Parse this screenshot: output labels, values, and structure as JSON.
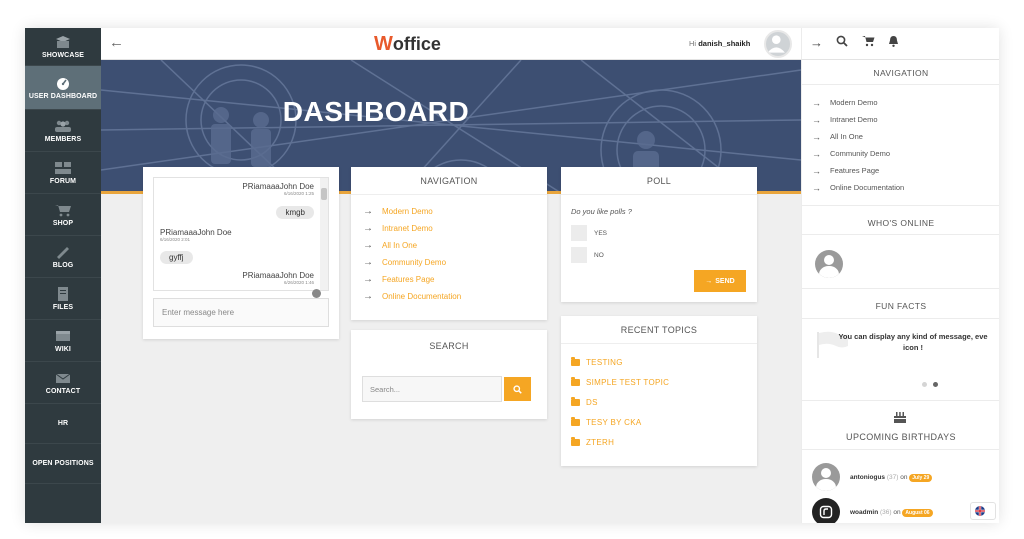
{
  "sidebar": {
    "items": [
      {
        "label": "SHOWCASE",
        "icon": "showcase-icon"
      },
      {
        "label": "USER DASHBOARD",
        "icon": "dashboard-gauge-icon"
      },
      {
        "label": "MEMBERS",
        "icon": "members-icon"
      },
      {
        "label": "FORUM",
        "icon": "forum-icon"
      },
      {
        "label": "SHOP",
        "icon": "cart-icon"
      },
      {
        "label": "BLOG",
        "icon": "blog-icon"
      },
      {
        "label": "FILES",
        "icon": "files-icon"
      },
      {
        "label": "WIKI",
        "icon": "wiki-icon"
      },
      {
        "label": "CONTACT",
        "icon": "contact-icon"
      },
      {
        "label": "HR",
        "icon": ""
      },
      {
        "label": "OPEN POSITIONS",
        "icon": ""
      }
    ]
  },
  "header": {
    "logo_first": "W",
    "logo_rest": "office",
    "greeting": "Hi",
    "username": "danish_shaikh"
  },
  "hero": {
    "title": "DASHBOARD"
  },
  "chat": {
    "messages": [
      {
        "name": "PRiamaaaJohn Doe",
        "time": "6/16/2020 1:25",
        "text": "kmgb",
        "side": "right"
      },
      {
        "name": "PRiamaaaJohn Doe",
        "time": "6/16/2020 2:01",
        "text": "gyffj",
        "side": "left"
      },
      {
        "name": "PRiamaaaJohn Doe",
        "time": "6/26/2020 1:46",
        "text": "",
        "side": "right"
      }
    ],
    "input_placeholder": "Enter message here"
  },
  "navigation_widget": {
    "title": "NAVIGATION",
    "items": [
      "Modern Demo",
      "Intranet Demo",
      "All In One",
      "Community Demo",
      "Features Page",
      "Online Documentation"
    ]
  },
  "search_widget": {
    "title": "SEARCH",
    "placeholder": "Search..."
  },
  "poll_widget": {
    "title": "POLL",
    "question": "Do you like polls ?",
    "options": [
      "YES",
      "NO"
    ],
    "send_label": "SEND"
  },
  "topics_widget": {
    "title": "RECENT TOPICS",
    "items": [
      "TESTING",
      "SIMPLE TEST TOPIC",
      "DS",
      "TESY BY CKA",
      "ZTERH"
    ]
  },
  "right_sidebar": {
    "nav_title": "NAVIGATION",
    "nav_items": [
      "Modern Demo",
      "Intranet Demo",
      "All In One",
      "Community Demo",
      "Features Page",
      "Online Documentation"
    ],
    "online_title": "WHO'S ONLINE",
    "fun_title": "FUN FACTS",
    "fun_text": "You can display any kind of message, eve",
    "fun_text2": "icon !",
    "birthdays_title": "UPCOMING BIRTHDAYS",
    "birthdays": [
      {
        "name": "antoniogus",
        "age": "(37)",
        "on": "on",
        "date": "July 29"
      },
      {
        "name": "woadmin",
        "age": "(36)",
        "on": "on",
        "date": "August 06"
      }
    ]
  },
  "colors": {
    "accent": "#f5a623",
    "sidebar_bg": "#2f3a3f",
    "hero_bg": "#3d4f72"
  }
}
